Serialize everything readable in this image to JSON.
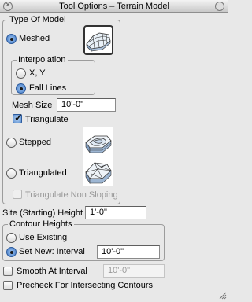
{
  "window": {
    "title": "Tool Options – Terrain Model"
  },
  "model_type": {
    "group_label": "Type Of Model",
    "meshed": {
      "label": "Meshed",
      "selected": true,
      "icon": "meshed-terrain-icon"
    },
    "interpolation": {
      "group_label": "Interpolation",
      "xy": {
        "label": "X, Y",
        "selected": false
      },
      "fall_lines": {
        "label": "Fall Lines",
        "selected": true
      }
    },
    "mesh_size": {
      "label": "Mesh Size",
      "value": "10'-0\""
    },
    "triangulate": {
      "label": "Triangulate",
      "checked": true
    },
    "stepped": {
      "label": "Stepped",
      "selected": false,
      "icon": "stepped-terrain-icon"
    },
    "triangulated": {
      "label": "Triangulated",
      "selected": false,
      "icon": "triangulated-terrain-icon"
    },
    "triangulate_non_sloping": {
      "label": "Triangulate Non Sloping",
      "checked": false,
      "enabled": false
    }
  },
  "site_height": {
    "label": "Site (Starting) Height",
    "value": "1'-0\""
  },
  "contour_heights": {
    "group_label": "Contour Heights",
    "use_existing": {
      "label": "Use Existing",
      "selected": false
    },
    "set_new": {
      "label": "Set New: Interval",
      "selected": true,
      "value": "10'-0\""
    }
  },
  "smooth": {
    "label": "Smooth At Interval",
    "checked": false,
    "value": "10'-0\""
  },
  "precheck": {
    "label": "Precheck For Intersecting Contours",
    "checked": false
  },
  "colors": {
    "selected_radio": "#3f79c6",
    "group_border": "#9c9c9c",
    "background": "#e8e8e8"
  }
}
